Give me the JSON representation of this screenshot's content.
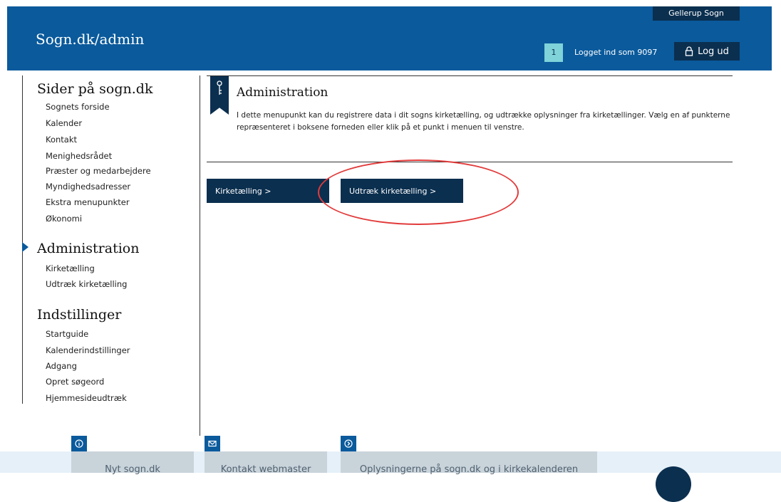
{
  "header": {
    "site_title": "Sogn.dk/admin",
    "parish": "Gellerup Sogn",
    "notification_count": "1",
    "logged_in": "Logget ind som 9097",
    "logout_label": "Log ud"
  },
  "sidebar": {
    "sections": [
      {
        "title": "Sider på sogn.dk",
        "items": [
          "Sognets forside",
          "Kalender",
          "Kontakt",
          "Menighedsrådet",
          "Præster og medarbejdere",
          "Myndighedsadresser",
          "Ekstra menupunkter",
          "Økonomi"
        ]
      },
      {
        "title": "Administration",
        "items": [
          "Kirketælling",
          "Udtræk kirketælling"
        ]
      },
      {
        "title": "Indstillinger",
        "items": [
          "Startguide",
          "Kalenderindstillinger",
          "Adgang",
          "Opret søgeord",
          "Hjemmesideudtræk"
        ]
      }
    ]
  },
  "main": {
    "title": "Administration",
    "description": "I dette menupunkt kan du registrere data i dit sogns kirketælling, og udtrække oplysninger fra kirketællinger. Vælg en af punkterne repræsenteret i boksene forneden eller klik på et punkt i menuen til venstre.",
    "boxes": [
      "Kirketælling >",
      "Udtræk kirketælling >"
    ]
  },
  "footer": {
    "items": [
      "Nyt sogn.dk",
      "Kontakt webmaster",
      "Oplysningerne på sogn.dk og i kirkekalenderen"
    ]
  },
  "colors": {
    "brand": "#0a5a9c",
    "dark": "#0b2f4f",
    "highlight": "#e23b3b"
  }
}
